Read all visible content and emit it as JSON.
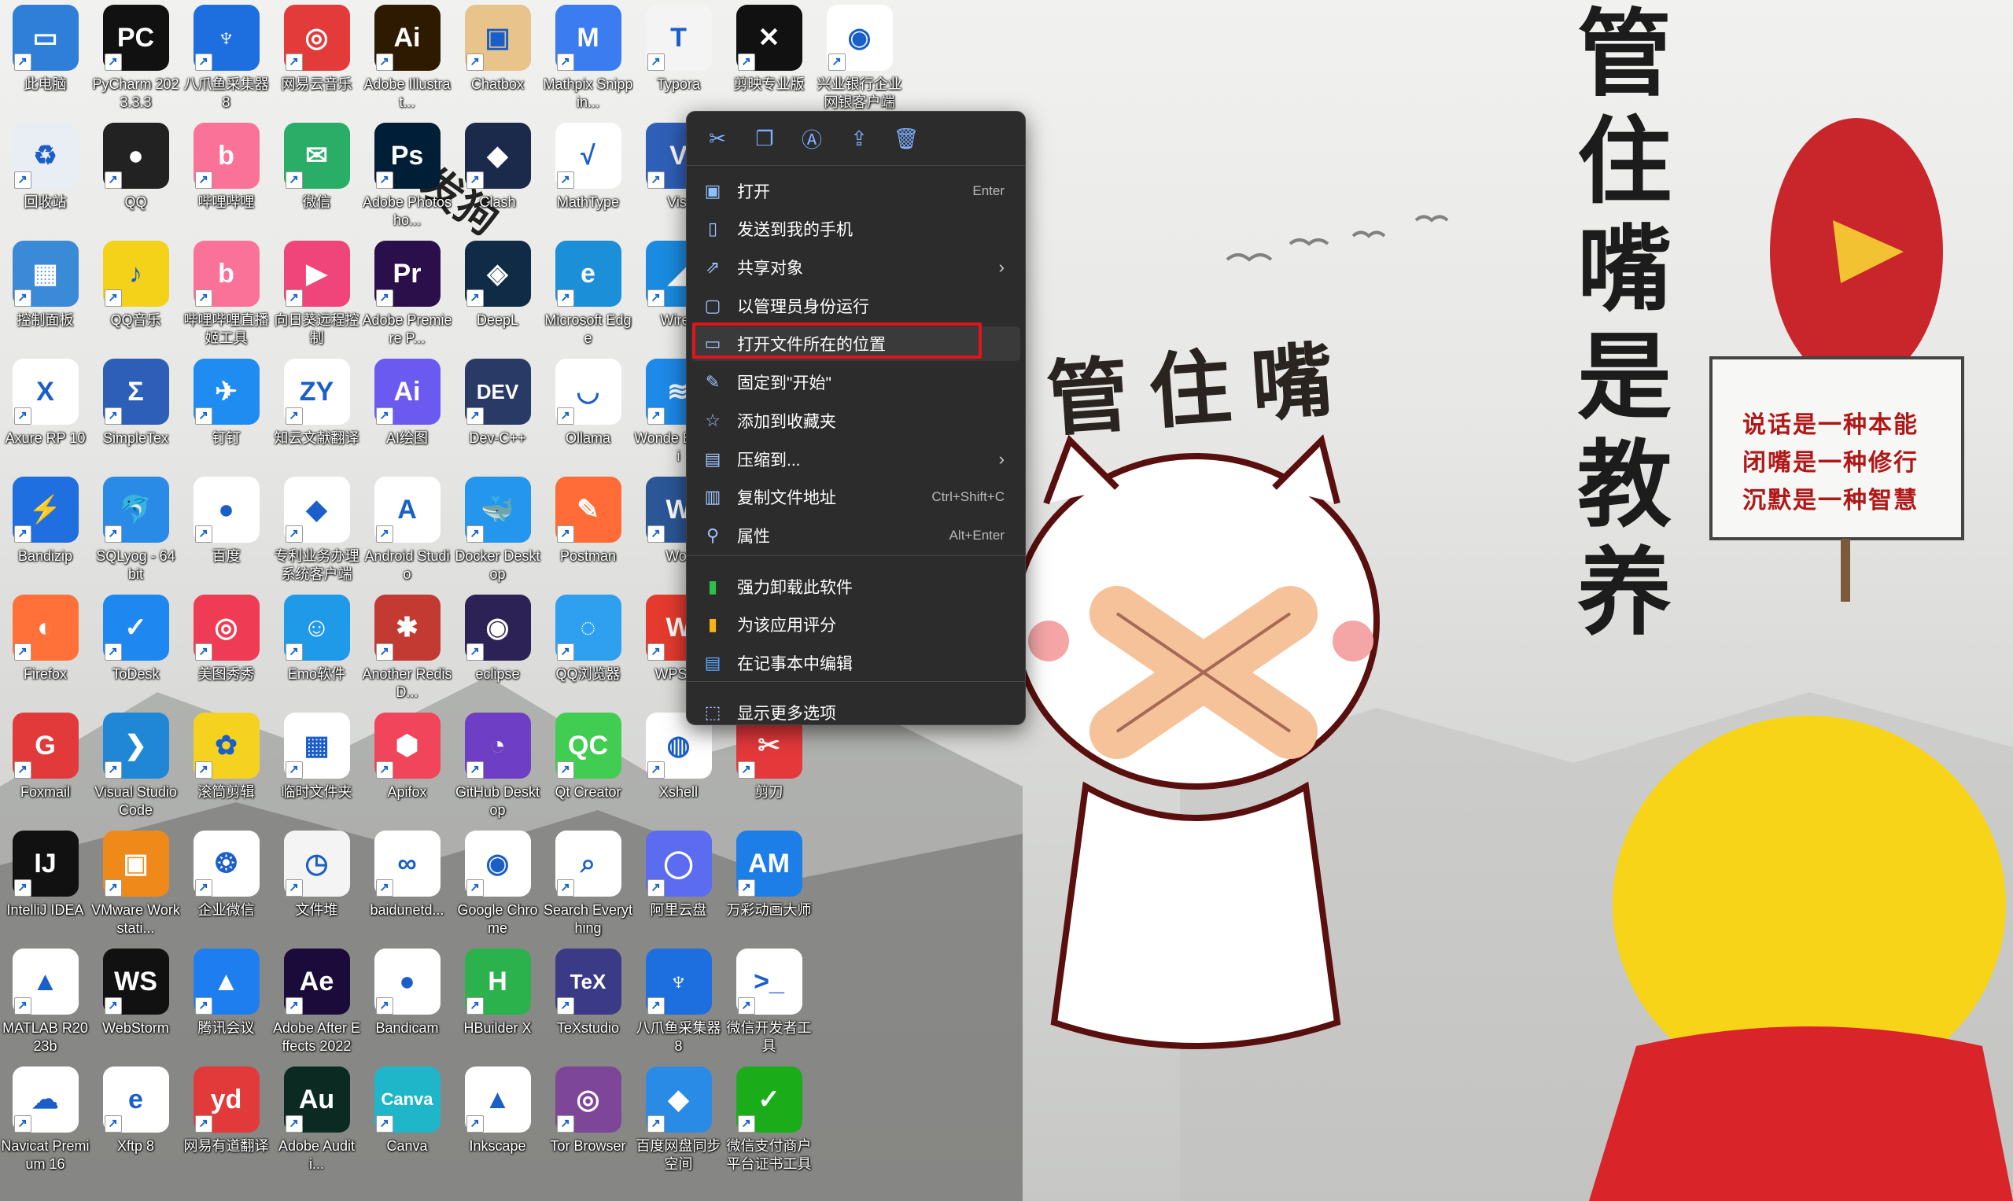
{
  "wallpaper": {
    "vertical_text": [
      "管",
      "住",
      "嘴",
      "是",
      "教",
      "养"
    ],
    "brush_text": "管住嘴",
    "sign_lines": [
      "说话是一种本能",
      "闭嘴是一种修行",
      "沉默是一种智慧"
    ],
    "sticker_text": "发狗"
  },
  "desktop_icons": [
    {
      "label": "此电脑",
      "glyph": "▭",
      "color": "#2f7fd8",
      "icon": "computer-icon"
    },
    {
      "label": "PyCharm 2023.3.3",
      "glyph": "PC",
      "color": "#111111",
      "icon": "pycharm-icon"
    },
    {
      "label": "八爪鱼采集器 8",
      "glyph": "♆",
      "color": "#1d6fe0",
      "icon": "octopus-icon"
    },
    {
      "label": "网易云音乐",
      "glyph": "◎",
      "color": "#e33a3a",
      "icon": "netease-music-icon"
    },
    {
      "label": "Adobe Illustrat...",
      "glyph": "Ai",
      "color": "#2e1a00",
      "icon": "illustrator-icon"
    },
    {
      "label": "Chatbox",
      "glyph": "▣",
      "color": "#e8c48a",
      "icon": "chatbox-icon"
    },
    {
      "label": "Mathpix Snippin...",
      "glyph": "M",
      "color": "#3b7cf0",
      "icon": "mathpix-icon"
    },
    {
      "label": "Typora",
      "glyph": "T",
      "color": "#f4f4f4",
      "icon": "typora-icon"
    },
    {
      "label": "剪映专业版",
      "glyph": "✕",
      "color": "#111111",
      "icon": "jianying-icon"
    },
    {
      "label": "兴业银行企业网银客户端",
      "glyph": "◉",
      "color": "#ffffff",
      "icon": "bank-icon"
    },
    {
      "label": "回收站",
      "glyph": "♻",
      "color": "#e9eef5",
      "icon": "recycle-bin-icon"
    },
    {
      "label": "QQ",
      "glyph": "●",
      "color": "#222222",
      "icon": "qq-icon"
    },
    {
      "label": "哔哩哔哩",
      "glyph": "b",
      "color": "#fb7299",
      "icon": "bilibili-icon"
    },
    {
      "label": "微信",
      "glyph": "✉",
      "color": "#2aae67",
      "icon": "wechat-icon"
    },
    {
      "label": "Adobe Photosho...",
      "glyph": "Ps",
      "color": "#001e36",
      "icon": "photoshop-icon"
    },
    {
      "label": "Clash",
      "glyph": "◆",
      "color": "#1b2a4a",
      "icon": "clash-icon"
    },
    {
      "label": "MathType",
      "glyph": "√",
      "color": "#ffffff",
      "icon": "mathtype-icon"
    },
    {
      "label": "Visi",
      "glyph": "V",
      "color": "#2f5fb8",
      "icon": "visio-icon"
    },
    {
      "label": "控制面板",
      "glyph": "▦",
      "color": "#3b8ad8",
      "icon": "control-panel-icon"
    },
    {
      "label": "QQ音乐",
      "glyph": "♪",
      "color": "#f4d21a",
      "icon": "qq-music-icon"
    },
    {
      "label": "哔哩哔哩直播姬工具",
      "glyph": "b",
      "color": "#fb7299",
      "icon": "bilibili-live-icon"
    },
    {
      "label": "向日葵远程控制",
      "glyph": "▶",
      "color": "#f0457a",
      "icon": "sunlogin-icon"
    },
    {
      "label": "Adobe Premiere P...",
      "glyph": "Pr",
      "color": "#2a0f4a",
      "icon": "premiere-icon"
    },
    {
      "label": "DeepL",
      "glyph": "◈",
      "color": "#0f2b46",
      "icon": "deepl-icon"
    },
    {
      "label": "Microsoft Edge",
      "glyph": "e",
      "color": "#1b8fd8",
      "icon": "edge-icon"
    },
    {
      "label": "Wires",
      "glyph": "◢",
      "color": "#1a8be0",
      "icon": "wireshark-icon"
    },
    {
      "label": "Axure RP 10",
      "glyph": "X",
      "color": "#ffffff",
      "icon": "axure-icon"
    },
    {
      "label": "SimpleTex",
      "glyph": "Σ",
      "color": "#2d5fb8",
      "icon": "simpletex-icon"
    },
    {
      "label": "钉钉",
      "glyph": "✈",
      "color": "#1e8cf0",
      "icon": "dingtalk-icon"
    },
    {
      "label": "知云文献翻译",
      "glyph": "ZY",
      "color": "#ffffff",
      "icon": "zhiyun-icon"
    },
    {
      "label": "AI绘图",
      "glyph": "Ai",
      "color": "#6a5af0",
      "icon": "ai-draw-icon"
    },
    {
      "label": "Dev-C++",
      "glyph": "DEV",
      "color": "#2a3a66",
      "icon": "devcpp-icon"
    },
    {
      "label": "Ollama",
      "glyph": "◡",
      "color": "#ffffff",
      "icon": "ollama-icon"
    },
    {
      "label": "Wonde Edrawi",
      "glyph": "≋",
      "color": "#1d8ae8",
      "icon": "edraw-icon"
    },
    {
      "label": "Bandizip",
      "glyph": "⚡",
      "color": "#1f6fe0",
      "icon": "bandizip-icon"
    },
    {
      "label": "SQLyog - 64 bit",
      "glyph": "🐬",
      "color": "#2a8be6",
      "icon": "sqlyog-icon"
    },
    {
      "label": "百度",
      "glyph": "●",
      "color": "#ffffff",
      "icon": "baidu-icon"
    },
    {
      "label": "专利业务办理系统客户端",
      "glyph": "◆",
      "color": "#ffffff",
      "icon": "patent-icon"
    },
    {
      "label": "Android Studio",
      "glyph": "A",
      "color": "#ffffff",
      "icon": "android-studio-icon"
    },
    {
      "label": "Docker Desktop",
      "glyph": "🐳",
      "color": "#2496ed",
      "icon": "docker-icon"
    },
    {
      "label": "Postman",
      "glyph": "✎",
      "color": "#ff6c37",
      "icon": "postman-icon"
    },
    {
      "label": "Wor",
      "glyph": "W",
      "color": "#2b5797",
      "icon": "word-icon"
    },
    {
      "label": "Firefox",
      "glyph": "◐",
      "color": "#ff7139",
      "icon": "firefox-icon"
    },
    {
      "label": "ToDesk",
      "glyph": "✓",
      "color": "#1e88f0",
      "icon": "todesk-icon"
    },
    {
      "label": "美图秀秀",
      "glyph": "◎",
      "color": "#ef3b53",
      "icon": "meitu-icon"
    },
    {
      "label": "Emo软件",
      "glyph": "☺",
      "color": "#1f9ae8",
      "icon": "emo-icon"
    },
    {
      "label": "Another Redis D...",
      "glyph": "✱",
      "color": "#c23a32",
      "icon": "redis-icon"
    },
    {
      "label": "eclipse",
      "glyph": "◉",
      "color": "#2c2255",
      "icon": "eclipse-icon"
    },
    {
      "label": "QQ浏览器",
      "glyph": "◌",
      "color": "#2f9ff0",
      "icon": "qq-browser-icon"
    },
    {
      "label": "WPS O",
      "glyph": "W",
      "color": "#e53b2f",
      "icon": "wps-icon"
    },
    {
      "label": "Foxmail",
      "glyph": "G",
      "color": "#e23a3a",
      "icon": "foxmail-icon"
    },
    {
      "label": "Visual Studio Code",
      "glyph": "❯",
      "color": "#1f87d6",
      "icon": "vscode-icon"
    },
    {
      "label": "滚筒剪辑",
      "glyph": "✿",
      "color": "#f5d21f",
      "icon": "clip-icon"
    },
    {
      "label": "临时文件夹",
      "glyph": "▦",
      "color": "#ffffff",
      "icon": "temp-folder-icon"
    },
    {
      "label": "Apifox",
      "glyph": "⬢",
      "color": "#f0455a",
      "icon": "apifox-icon"
    },
    {
      "label": "GitHub Desktop",
      "glyph": "◔",
      "color": "#6e3fc4",
      "icon": "github-desktop-icon"
    },
    {
      "label": "Qt Creator",
      "glyph": "QC",
      "color": "#41cd52",
      "icon": "qt-creator-icon"
    },
    {
      "label": "Xshell",
      "glyph": "◍",
      "color": "#ffffff",
      "icon": "xshell-icon"
    },
    {
      "label": "剪刀",
      "glyph": "✂",
      "color": "#e5383b",
      "icon": "scissors-icon"
    },
    {
      "label": "IntelliJ IDEA",
      "glyph": "IJ",
      "color": "#111111",
      "icon": "intellij-icon"
    },
    {
      "label": "VMware Workstati...",
      "glyph": "▣",
      "color": "#ef8a1a",
      "icon": "vmware-icon"
    },
    {
      "label": "企业微信",
      "glyph": "❂",
      "color": "#ffffff",
      "icon": "wecom-icon"
    },
    {
      "label": "文件堆",
      "glyph": "◷",
      "color": "#f4f4f4",
      "icon": "file-stack-icon"
    },
    {
      "label": "baidunetd...",
      "glyph": "∞",
      "color": "#ffffff",
      "icon": "baidu-netdisk-icon"
    },
    {
      "label": "Google Chrome",
      "glyph": "◉",
      "color": "#ffffff",
      "icon": "chrome-icon"
    },
    {
      "label": "Search Everything",
      "glyph": "⌕",
      "color": "#ffffff",
      "icon": "everything-icon"
    },
    {
      "label": "阿里云盘",
      "glyph": "◯",
      "color": "#5b6cf0",
      "icon": "aliyun-drive-icon"
    },
    {
      "label": "万彩动画大师",
      "glyph": "AM",
      "color": "#1e7ee8",
      "icon": "animiz-icon"
    },
    {
      "label": "MATLAB R2023b",
      "glyph": "▲",
      "color": "#ffffff",
      "icon": "matlab-icon"
    },
    {
      "label": "WebStorm",
      "glyph": "WS",
      "color": "#111111",
      "icon": "webstorm-icon"
    },
    {
      "label": "腾讯会议",
      "glyph": "▲",
      "color": "#1e7ef0",
      "icon": "tencent-meeting-icon"
    },
    {
      "label": "Adobe After Effects 2022",
      "glyph": "Ae",
      "color": "#1a0b3a",
      "icon": "after-effects-icon"
    },
    {
      "label": "Bandicam",
      "glyph": "●",
      "color": "#ffffff",
      "icon": "bandicam-icon"
    },
    {
      "label": "HBuilder X",
      "glyph": "H",
      "color": "#2bb24c",
      "icon": "hbuilder-icon"
    },
    {
      "label": "TeXstudio",
      "glyph": "TeX",
      "color": "#3a3a86",
      "icon": "texstudio-icon"
    },
    {
      "label": "八爪鱼采集器 8",
      "glyph": "♆",
      "color": "#1d6fe0",
      "icon": "octopus-icon-2"
    },
    {
      "label": "微信开发者工具",
      "glyph": ">_",
      "color": "#ffffff",
      "icon": "wechat-devtools-icon"
    },
    {
      "label": "Navicat Premium 16",
      "glyph": "☁",
      "color": "#ffffff",
      "icon": "navicat-icon"
    },
    {
      "label": "Xftp 8",
      "glyph": "e",
      "color": "#ffffff",
      "icon": "xftp-icon"
    },
    {
      "label": "网易有道翻译",
      "glyph": "yd",
      "color": "#e23a3a",
      "icon": "youdao-icon"
    },
    {
      "label": "Adobe Auditi...",
      "glyph": "Au",
      "color": "#0a2a22",
      "icon": "audition-icon"
    },
    {
      "label": "Canva",
      "glyph": "Canva",
      "color": "#1fb6c9",
      "icon": "canva-icon"
    },
    {
      "label": "Inkscape",
      "glyph": "▲",
      "color": "#ffffff",
      "icon": "inkscape-icon"
    },
    {
      "label": "Tor Browser",
      "glyph": "◎",
      "color": "#7d4698",
      "icon": "tor-icon"
    },
    {
      "label": "百度网盘同步空间",
      "glyph": "◆",
      "color": "#2a8be6",
      "icon": "baidu-sync-icon"
    },
    {
      "label": "微信支付商户平台证书工具",
      "glyph": "✓",
      "color": "#1aad19",
      "icon": "wechat-pay-icon"
    }
  ],
  "context_menu": {
    "toolbar": [
      {
        "name": "cut",
        "glyph": "✂",
        "icon": "cut-icon"
      },
      {
        "name": "copy",
        "glyph": "❐",
        "icon": "copy-icon"
      },
      {
        "name": "rename",
        "glyph": "Ⓐ",
        "icon": "rename-icon"
      },
      {
        "name": "share",
        "glyph": "⇪",
        "icon": "share-icon"
      },
      {
        "name": "delete",
        "glyph": "🗑",
        "icon": "delete-icon"
      }
    ],
    "items": [
      {
        "label": "打开",
        "shortcut": "Enter",
        "glyph": "▣",
        "icon": "open-icon",
        "submenu": false
      },
      {
        "label": "发送到我的手机",
        "shortcut": "",
        "glyph": "▯",
        "icon": "phone-icon",
        "submenu": false
      },
      {
        "label": "共享对象",
        "shortcut": "",
        "glyph": "⇗",
        "icon": "share-with-icon",
        "submenu": true
      },
      {
        "label": "以管理员身份运行",
        "shortcut": "",
        "glyph": "▢",
        "icon": "admin-run-icon",
        "submenu": false
      },
      {
        "label": "打开文件所在的位置",
        "shortcut": "",
        "glyph": "▭",
        "icon": "folder-icon",
        "submenu": false
      },
      {
        "label": "固定到\"开始\"",
        "shortcut": "",
        "glyph": "✎",
        "icon": "pin-icon",
        "submenu": false
      },
      {
        "label": "添加到收藏夹",
        "shortcut": "",
        "glyph": "☆",
        "icon": "star-icon",
        "submenu": false
      },
      {
        "label": "压缩到...",
        "shortcut": "",
        "glyph": "▤",
        "icon": "compress-icon",
        "submenu": true
      },
      {
        "label": "复制文件地址",
        "shortcut": "Ctrl+Shift+C",
        "glyph": "▥",
        "icon": "copy-path-icon",
        "submenu": false
      },
      {
        "label": "属性",
        "shortcut": "Alt+Enter",
        "glyph": "⚲",
        "icon": "properties-icon",
        "submenu": false
      },
      {
        "label": "强力卸载此软件",
        "shortcut": "",
        "glyph": "▮",
        "icon": "uninstall-icon",
        "submenu": false
      },
      {
        "label": "为该应用评分",
        "shortcut": "",
        "glyph": "▮",
        "icon": "rate-icon",
        "submenu": false
      },
      {
        "label": "在记事本中编辑",
        "shortcut": "",
        "glyph": "▤",
        "icon": "notepad-icon",
        "submenu": false
      },
      {
        "label": "显示更多选项",
        "shortcut": "",
        "glyph": "⬚",
        "icon": "more-options-icon",
        "submenu": false
      }
    ],
    "highlighted_index": 4,
    "highlight_color": "#e0141c"
  }
}
